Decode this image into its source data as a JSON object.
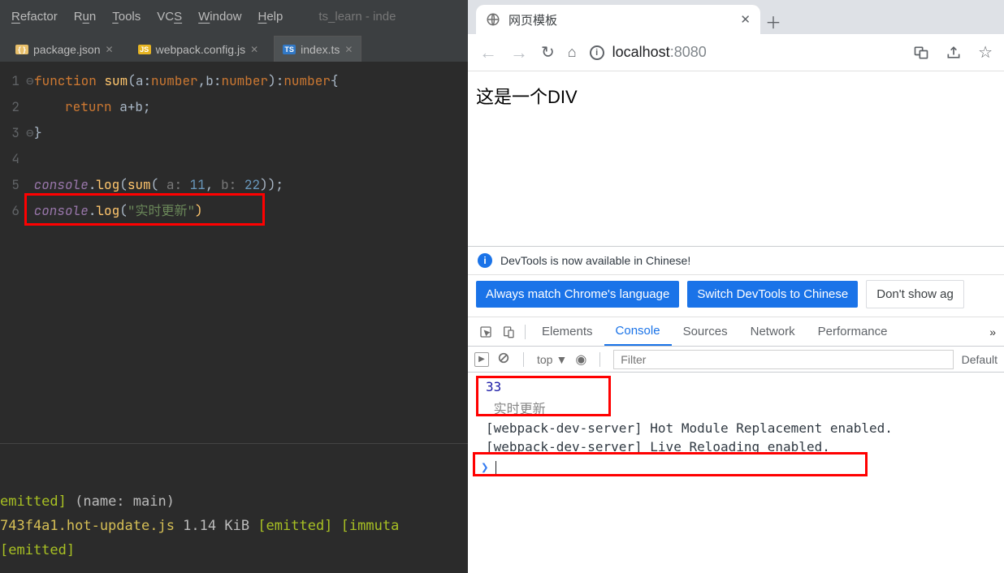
{
  "ide": {
    "menus": [
      "Refactor",
      "Run",
      "Tools",
      "VCS",
      "Window",
      "Help"
    ],
    "menu_underline_idx": [
      0,
      0,
      0,
      2,
      0,
      0
    ],
    "window_title": "ts_learn - inde",
    "tabs": [
      {
        "icon": "json",
        "label": "package.json",
        "active": false
      },
      {
        "icon": "js",
        "label": "webpack.config.js",
        "active": false
      },
      {
        "icon": "ts",
        "label": "index.ts",
        "active": true
      }
    ],
    "code_hints": {
      "a": "a:",
      "b": "b:"
    },
    "gutter": [
      "1",
      "2",
      "3",
      "4",
      "5",
      "6"
    ],
    "code": {
      "l1": {
        "kw": "function ",
        "fn": "sum",
        "lp": "(",
        "p1": "a",
        "c1": ":",
        "t1": "number",
        "cm": ",",
        "p2": "b",
        "c2": ":",
        "t2": "number",
        "rp": ")",
        "c3": ":",
        "t3": "number",
        "ob": "{"
      },
      "l2": {
        "kw": "return ",
        "expr": "a+b",
        "sc": ";"
      },
      "l3": {
        "cb": "}"
      },
      "l5": {
        "obj": "console",
        "dot": ".",
        "fn": "log",
        "lp": "(",
        "fn2": "sum",
        "lp2": "(",
        "h1": " a: ",
        "v1": "11",
        "cm": ",",
        "h2": " b: ",
        "v2": "22",
        "rp2": ")",
        "rp": ")",
        "sc": ";"
      },
      "l6": {
        "obj": "console",
        "dot": ".",
        "fn": "log",
        "lp": "(",
        "str": "\"实时更新\"",
        "rp": ")"
      }
    },
    "terminal": {
      "l1a": "emitted]",
      "l1b": " (name: main)",
      "l2a": "743f4a1.hot-update.js",
      "l2b": " 1.14 KiB ",
      "l2c": "[emitted]",
      "l2d": " ",
      "l2e": "[immuta",
      "l3": "[emitted]"
    }
  },
  "browser": {
    "tab_title": "网页模板",
    "nav": {
      "back": "←",
      "forward": "→",
      "reload": "⟳",
      "home": "⌂"
    },
    "url": {
      "scheme_icon": "i",
      "host": "localhost",
      "port": ":8080"
    },
    "icons": {
      "translate": "⠿",
      "share": "↗",
      "star": "☆"
    },
    "page_text": "这是一个DIV"
  },
  "devtools": {
    "info_text": "DevTools is now available in Chinese!",
    "btn_match": "Always match Chrome's language",
    "btn_switch": "Switch DevTools to Chinese",
    "btn_dont": "Don't show ag",
    "tabs": [
      "Elements",
      "Console",
      "Sources",
      "Network",
      "Performance"
    ],
    "active_tab": 1,
    "context": "top",
    "filter_placeholder": "Filter",
    "level": "Default",
    "console": {
      "r1": "33",
      "r2": "实时更新",
      "r3": "[webpack-dev-server] Hot Module Replacement enabled.",
      "r4": "[webpack-dev-server] Live Reloading enabled."
    }
  }
}
